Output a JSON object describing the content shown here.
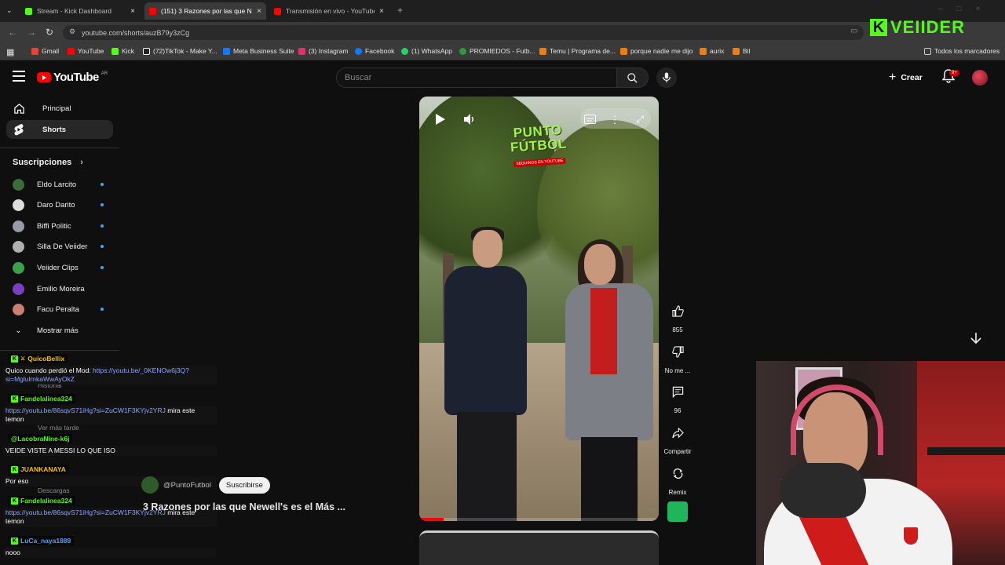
{
  "browser": {
    "tabs": [
      {
        "label": "Stream - Kick Dashboard",
        "color": "#53fc18"
      },
      {
        "label": "(151) 3 Razones por las que Ne",
        "color": "#ff0000"
      },
      {
        "label": "Transmisión en vivo - YouTube",
        "color": "#ff0000"
      }
    ],
    "new_tab": "+",
    "url": "youtube.com/shorts/auzB79y3zCg",
    "bookmarks": [
      {
        "label": "Gmail",
        "color": "#ea4335"
      },
      {
        "label": "YouTube",
        "color": "#ff0000"
      },
      {
        "label": "Kick",
        "color": "#53fc18"
      },
      {
        "label": "(72)TikTok - Make Y...",
        "color": "#ffffff"
      },
      {
        "label": "Meta Business Suite",
        "color": "#1877f2"
      },
      {
        "label": "(3) Instagram",
        "color": "#e1306c"
      },
      {
        "label": "Facebook",
        "color": "#1877f2"
      },
      {
        "label": "(1) WhatsApp",
        "color": "#25d366"
      },
      {
        "label": "PROMIEDOS - Futb...",
        "color": "#2e9a3a"
      },
      {
        "label": "Temu | Programa de...",
        "color": "#f57c00"
      },
      {
        "label": "porque nadie me dijo",
        "color": "#f57c00"
      },
      {
        "label": "aurix",
        "color": "#f57c00"
      },
      {
        "label": "Bil",
        "color": "#f57c00"
      }
    ],
    "all_bookmarks": "Todos los marcadores"
  },
  "youtube": {
    "logo_text": "YouTube",
    "country_code": "AR",
    "search_placeholder": "Buscar",
    "create_label": "Crear",
    "notif_badge": "9+"
  },
  "sidebar": {
    "main": [
      {
        "label": "Principal",
        "icon": "home-icon"
      },
      {
        "label": "Shorts",
        "icon": "shorts-icon"
      }
    ],
    "subs_title": "Suscripciones",
    "subscriptions": [
      {
        "label": "Eldo Larcito",
        "color": "#3d6b3a"
      },
      {
        "label": "Daro Darito",
        "color": "#dddddd"
      },
      {
        "label": "Biffi Politic",
        "color": "#9a9aa8"
      },
      {
        "label": "Silla De Veiider",
        "color": "#b0b0b0"
      },
      {
        "label": "Veiider Clips",
        "color": "#3aa04a"
      },
      {
        "label": "Emilio Moreira",
        "color": "#7a3fc0"
      },
      {
        "label": "Facu Peralta",
        "color": "#c98070"
      }
    ],
    "show_more": "Mostrar más",
    "hidden_items": [
      "Historial",
      "Ver más tarde",
      "Descargas"
    ]
  },
  "chat": [
    {
      "user": "QuicoBellix",
      "user_color": "#f2c200",
      "text": "Quico cuando perdió el Mod: ",
      "link": "https://youtu.be/_0KENOw6j3Q?si=MglulrnkaWwAyOkZ"
    },
    {
      "user": "Fandelalinea324",
      "user_color": "#53fc18",
      "text": " mira este temon",
      "link": "https://youtu.be/86sqvS71iHg?si=ZuCW1F3KYjv2YRJ"
    },
    {
      "user": "@LacobraNine-k6j",
      "user_color": "#53fc18",
      "text": "VEIDE VISTE A MESSI LO QUE ISO",
      "link": ""
    },
    {
      "user": "JUANKANAYA",
      "user_color": "#f2c200",
      "text": "Por eso",
      "link": ""
    },
    {
      "user": "Fandelalinea324",
      "user_color": "#53fc18",
      "text": " mira este temon",
      "link": "https://youtu.be/86sqvS71iHg?si=ZuCW1F3KYjv2YRJ"
    },
    {
      "user": "LuCa_naya1889",
      "user_color": "#4da3ff",
      "text": "nooo",
      "link": ""
    }
  ],
  "short": {
    "logo_line1": "PUNTO",
    "logo_line2": "FÚTBOL",
    "logo_tag": "SEGUINOS EN YOUTUBE",
    "progress": 0.1,
    "channel": "@PuntoFutbol",
    "subscribe": "Suscribirse",
    "title": "3 Razones por las que Newell's es el Más ..."
  },
  "actions": {
    "likes": "855",
    "dislike": "No me ...",
    "comments": "96",
    "share": "Compartir",
    "remix": "Remix"
  },
  "brand": {
    "k": "K",
    "name": "VEIIDER"
  }
}
